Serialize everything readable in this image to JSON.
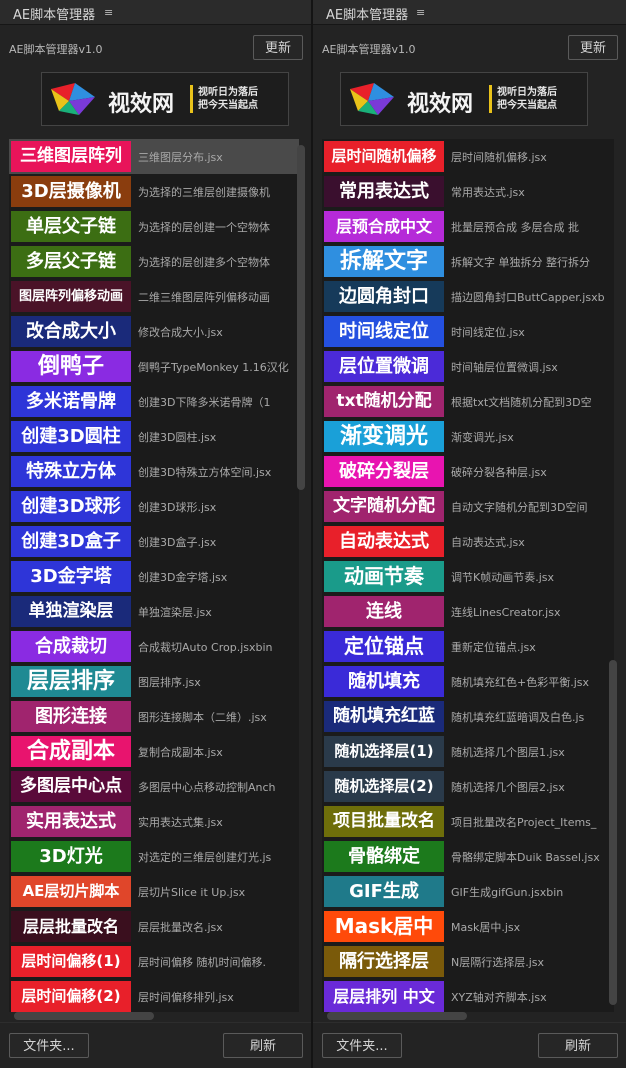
{
  "left": {
    "tab_title": "AE脚本管理器",
    "menu_icon": "≡",
    "app_title": "AE脚本管理器v1.0",
    "update_label": "更新",
    "banner": {
      "logo_text": "视效网",
      "slogan_1": "视听日为落后",
      "slogan_2": "把今天当起点"
    },
    "items": [
      {
        "label": "三维图层阵列",
        "desc": "三维图层分布.jsx",
        "color": "#e8145a",
        "size": 17,
        "selected": true
      },
      {
        "label": "3D层摄像机",
        "desc": "为选择的三维层创建摄像机",
        "color": "#8a3d0e",
        "size": 18
      },
      {
        "label": "单层父子链",
        "desc": "为选择的层创建一个空物体",
        "color": "#3c6e13",
        "size": 18
      },
      {
        "label": "多层父子链",
        "desc": "为选择的层创建多个空物体",
        "color": "#3c6e13",
        "size": 18
      },
      {
        "label": "图层阵列偏移动画",
        "desc": "二维三维图层阵列偏移动画",
        "color": "#4a1328",
        "size": 13
      },
      {
        "label": "改合成大小",
        "desc": "修改合成大小.jsx",
        "color": "#1a2a7a",
        "size": 18
      },
      {
        "label": "倒鸭子",
        "desc": "倒鸭子TypeMonkey 1.16汉化",
        "color": "#8a2be2",
        "size": 22
      },
      {
        "label": "多米诺骨牌",
        "desc": "创建3D下降多米诺骨牌（1",
        "color": "#2e35d8",
        "size": 18
      },
      {
        "label": "创建3D圆柱",
        "desc": "创建3D圆柱.jsx",
        "color": "#2e35d8",
        "size": 18
      },
      {
        "label": "特殊立方体",
        "desc": "创建3D特殊立方体空间.jsx",
        "color": "#2e35d8",
        "size": 18
      },
      {
        "label": "创建3D球形",
        "desc": "创建3D球形.jsx",
        "color": "#2e35d8",
        "size": 18
      },
      {
        "label": "创建3D盒子",
        "desc": "创建3D盒子.jsx",
        "color": "#2e35d8",
        "size": 18
      },
      {
        "label": "3D金字塔",
        "desc": "创建3D金字塔.jsx",
        "color": "#2e35d8",
        "size": 18
      },
      {
        "label": "单独渲染层",
        "desc": "单独渲染层.jsx",
        "color": "#1a2a7a",
        "size": 17
      },
      {
        "label": "合成裁切",
        "desc": "合成裁切Auto Crop.jsxbin",
        "color": "#8a2be2",
        "size": 18
      },
      {
        "label": "层层排序",
        "desc": "图层排序.jsx",
        "color": "#1f8a93",
        "size": 22
      },
      {
        "label": "图形连接",
        "desc": "图形连接脚本（二维）.jsx",
        "color": "#a0246e",
        "size": 18
      },
      {
        "label": "合成副本",
        "desc": "复制合成副本.jsx",
        "color": "#e8146e",
        "size": 22
      },
      {
        "label": "多图层中心点",
        "desc": "多图层中心点移动控制Anch",
        "color": "#5a0a3a",
        "size": 17
      },
      {
        "label": "实用表达式",
        "desc": "实用表达式集.jsx",
        "color": "#a0246e",
        "size": 18
      },
      {
        "label": "3D灯光",
        "desc": "对选定的三维层创建灯光.js",
        "color": "#1c7a1c",
        "size": 18
      },
      {
        "label": "AE层切片脚本",
        "desc": "层切片Slice it Up.jsx",
        "color": "#e0462a",
        "size": 15
      },
      {
        "label": "层层批量改名",
        "desc": "层层批量改名.jsx",
        "color": "#3a0f1e",
        "size": 16
      },
      {
        "label": "层时间偏移(1)",
        "desc": "层时间偏移  随机时间偏移.",
        "color": "#e8202a",
        "size": 15
      },
      {
        "label": "层时间偏移(2)",
        "desc": "层时间偏移排列.jsx",
        "color": "#e8202a",
        "size": 15
      }
    ],
    "folder_label": "文件夹...",
    "refresh_label": "刷新"
  },
  "right": {
    "tab_title": "AE脚本管理器",
    "menu_icon": "≡",
    "app_title": "AE脚本管理器v1.0",
    "update_label": "更新",
    "banner": {
      "logo_text": "视效网",
      "slogan_1": "视听日为落后",
      "slogan_2": "把今天当起点"
    },
    "items": [
      {
        "label": "层时间随机偏移",
        "desc": "层时间随机偏移.jsx",
        "color": "#e8202a",
        "size": 15
      },
      {
        "label": "常用表达式",
        "desc": "常用表达式.jsx",
        "color": "#3a0f2e",
        "size": 18
      },
      {
        "label": "层预合成中文",
        "desc": "批量层预合成 多层合成 批",
        "color": "#b52ad8",
        "size": 16
      },
      {
        "label": "拆解文字",
        "desc": "拆解文字 单独拆分 整行拆分",
        "color": "#2f8fe0",
        "size": 22
      },
      {
        "label": "边圆角封口",
        "desc": "描边圆角封口ButtCapper.jsxb",
        "color": "#163a5a",
        "size": 18
      },
      {
        "label": "时间线定位",
        "desc": "时间线定位.jsx",
        "color": "#2450e0",
        "size": 18
      },
      {
        "label": "层位置微调",
        "desc": "时间轴层位置微调.jsx",
        "color": "#4b2ad8",
        "size": 18
      },
      {
        "label": "txt随机分配",
        "desc": "根据txt文档随机分配到3D空",
        "color": "#a0246e",
        "size": 17
      },
      {
        "label": "渐变调光",
        "desc": "渐变调光.jsx",
        "color": "#1aa0d8",
        "size": 22
      },
      {
        "label": "破碎分裂层",
        "desc": "破碎分裂各种层.jsx",
        "color": "#e814b0",
        "size": 18
      },
      {
        "label": "文字随机分配",
        "desc": "自动文字随机分配到3D空间",
        "color": "#a0246e",
        "size": 17
      },
      {
        "label": "自动表达式",
        "desc": "自动表达式.jsx",
        "color": "#e8202a",
        "size": 18
      },
      {
        "label": "动画节奏",
        "desc": "调节K帧动画节奏.jsx",
        "color": "#1a9b8a",
        "size": 20
      },
      {
        "label": "连线",
        "desc": "连线LinesCreator.jsx",
        "color": "#a0246e",
        "size": 18
      },
      {
        "label": "定位锚点",
        "desc": "重新定位锚点.jsx",
        "color": "#3a2ad8",
        "size": 20
      },
      {
        "label": "随机填充",
        "desc": "随机填充红色+色彩平衡.jsx",
        "color": "#3a2ad8",
        "size": 18
      },
      {
        "label": "随机填充红蓝",
        "desc": "随机填充红蓝暗调及白色.js",
        "color": "#1a2a7a",
        "size": 17
      },
      {
        "label": "随机选择层(1)",
        "desc": "随机选择几个图层1.jsx",
        "color": "#2a3a4a",
        "size": 15
      },
      {
        "label": "随机选择层(2)",
        "desc": "随机选择几个图层2.jsx",
        "color": "#2a3a4a",
        "size": 15
      },
      {
        "label": "项目批量改名",
        "desc": "项目批量改名Project_Items_",
        "color": "#6e6e0a",
        "size": 17
      },
      {
        "label": "骨骼绑定",
        "desc": "骨骼绑定脚本Duik Bassel.jsx",
        "color": "#1c7a1c",
        "size": 18
      },
      {
        "label": "GIF生成",
        "desc": "GIF生成gifGun.jsxbin",
        "color": "#1f7a8a",
        "size": 18
      },
      {
        "label": "Mask居中",
        "desc": "Mask居中.jsx",
        "color": "#ff4a0a",
        "size": 20
      },
      {
        "label": "隔行选择层",
        "desc": "N层隔行选择层.jsx",
        "color": "#7a5a0a",
        "size": 18
      },
      {
        "label": "层层排列 中文",
        "desc": "XYZ轴对齐脚本.jsx",
        "color": "#6a2ad8",
        "size": 16
      }
    ],
    "folder_label": "文件夹...",
    "refresh_label": "刷新"
  }
}
